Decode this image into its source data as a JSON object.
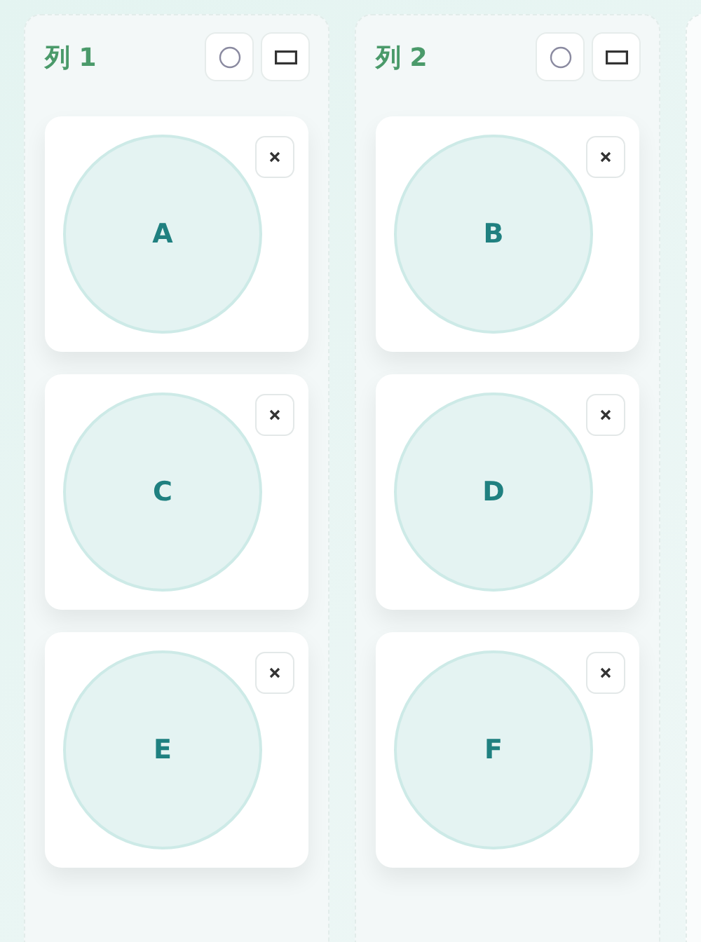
{
  "columns": [
    {
      "title": "列 1",
      "cards": [
        {
          "label": "A"
        },
        {
          "label": "C"
        },
        {
          "label": "E"
        }
      ]
    },
    {
      "title": "列 2",
      "cards": [
        {
          "label": "B"
        },
        {
          "label": "D"
        },
        {
          "label": "F"
        }
      ]
    }
  ]
}
